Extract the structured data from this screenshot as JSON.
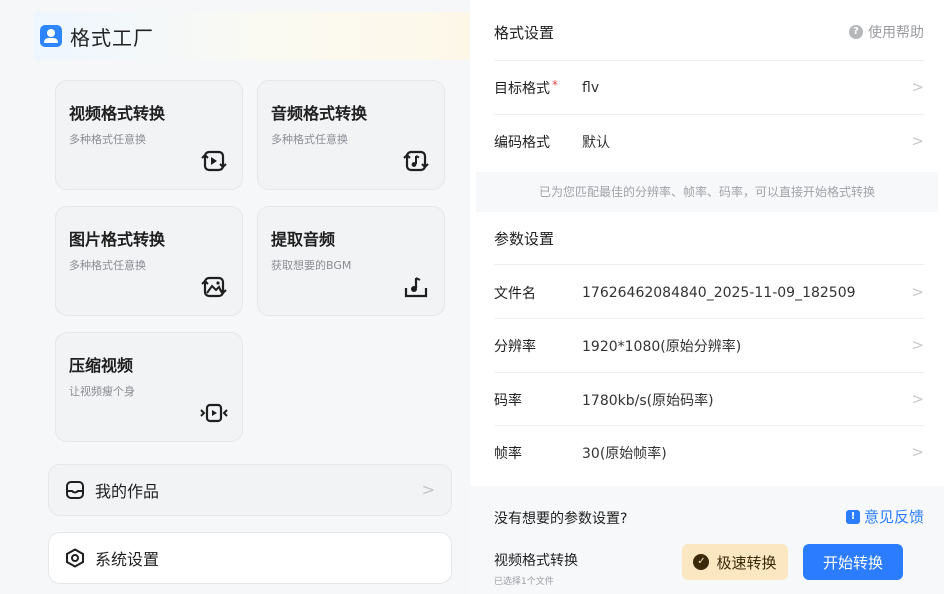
{
  "app": {
    "title": "格式工厂"
  },
  "cards": [
    {
      "title": "视频格式转换",
      "subtitle": "多种格式任意换",
      "icon": "video-convert-icon"
    },
    {
      "title": "音频格式转换",
      "subtitle": "多种格式任意换",
      "icon": "audio-convert-icon"
    },
    {
      "title": "图片格式转换",
      "subtitle": "多种格式任意换",
      "icon": "image-convert-icon"
    },
    {
      "title": "提取音频",
      "subtitle": "获取想要的BGM",
      "icon": "extract-audio-icon"
    },
    {
      "title": "压缩视频",
      "subtitle": "让视频瘦个身",
      "icon": "compress-video-icon"
    }
  ],
  "my_works": {
    "label": "我的作品",
    "icon": "inbox-icon"
  },
  "settings": {
    "label": "系统设置",
    "icon": "settings-icon"
  },
  "format_settings": {
    "title": "格式设置",
    "help": "使用帮助",
    "target_format_label": "目标格式",
    "required_mark": "*",
    "target_format_value": "flv",
    "codec_label": "编码格式",
    "codec_value": "默认",
    "hint": "已为您匹配最佳的分辨率、帧率、码率，可以直接开始格式转换"
  },
  "param_settings": {
    "title": "参数设置",
    "rows": [
      {
        "label": "文件名",
        "value": "17626462084840_2025-11-09_182509"
      },
      {
        "label": "分辨率",
        "value": "1920*1080(原始分辨率)"
      },
      {
        "label": "码率",
        "value": "1780kb/s(原始码率)"
      },
      {
        "label": "帧率",
        "value": "30(原始帧率)"
      }
    ]
  },
  "footer": {
    "question": "没有想要的参数设置?",
    "feedback": "意见反馈",
    "task_title": "视频格式转换",
    "selected": "已选择1个文件",
    "fast_convert": "极速转换",
    "start_convert": "开始转换"
  },
  "colors": {
    "accent": "#2b7cff",
    "fast_bg": "#fbe7c2",
    "required": "#e94b4b"
  }
}
